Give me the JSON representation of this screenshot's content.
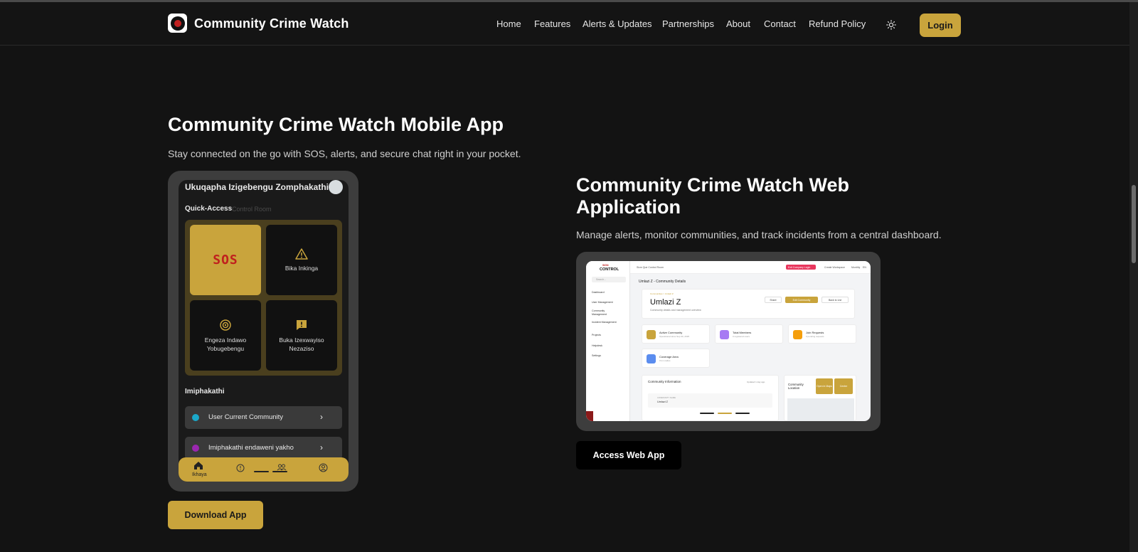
{
  "header": {
    "brand": "Community Crime Watch",
    "nav": [
      "Home",
      "Features",
      "Alerts & Updates",
      "Partnerships",
      "About",
      "Contact",
      "Refund Policy"
    ],
    "login_label": "Login",
    "theme_icon": "sun-icon"
  },
  "mobile": {
    "title": "Community Crime Watch Mobile App",
    "description": "Stay connected on the go with SOS, alerts, and secure chat right in your pocket.",
    "download_label": "Download App",
    "phone": {
      "title": "Ukuqapha Izigebengu Zomphakathi",
      "quick_access": "Quick-Access",
      "ghost_text": "Control Room",
      "tiles": [
        {
          "label": "SOS",
          "icon": "sos-text"
        },
        {
          "label": "Bika Inkinga",
          "icon": "warning-icon"
        },
        {
          "label": "Engeza Indawo Yobugebengu",
          "icon": "target-icon"
        },
        {
          "label": "Buka Izexwayiso Nezaziso",
          "icon": "alert-message-icon"
        }
      ],
      "section_title": "Imiphakathi",
      "rows": [
        {
          "label": "User Current Community",
          "dot_color": "#1ba8c9"
        },
        {
          "label": "Imiphakathi endaweni yakho",
          "dot_color": "#9b27b0"
        }
      ],
      "tab_home_label": "Ikhaya"
    }
  },
  "web": {
    "title": "Community Crime Watch Web Application",
    "description": "Manage alerts, monitor communities, and track incidents from a central dashboard.",
    "access_label": "Access Web App",
    "dashboard": {
      "logo_top": "SIGN",
      "logo": "CONTROL",
      "search": "Search...",
      "sidebar": [
        "Dashboard",
        "User Management",
        "Community Management",
        "Incident Management",
        "Projects",
        "Helpdesk",
        "Settings"
      ],
      "workspace": "Sicm Que Control Room",
      "exit_label": "Exit Company Login",
      "create_workspace": "Create Workspace",
      "month": "Monthly",
      "lang": "EN",
      "page_title": "Umlazi Z - Community Details",
      "breadcrumb": "Communities  >  Umlazi Z",
      "community_name": "Umlazi Z",
      "community_sub": "Community details and management overview",
      "share": "Share",
      "edit": "Edit Community",
      "back": "Back to List",
      "stats": [
        {
          "title": "Active Community",
          "sub": "Operational since Sep 30, 2025",
          "color": "#c9a43c"
        },
        {
          "title": "Total Members",
          "sub": "0 registered users",
          "color": "#a77bf3"
        },
        {
          "title": "Join Requests",
          "sub": "0 pending requests",
          "color": "#f59e0b"
        },
        {
          "title": "Coverage Area",
          "sub": "0 km radius",
          "color": "#5b8def"
        }
      ],
      "info_title": "Community Information",
      "updated": "Updated 1 day ago",
      "location_title": "Community Location",
      "open_maps": "Open in Maps",
      "center": "Center",
      "field_label": "COMMUNITY NAME",
      "field_value": "Umlazi Z"
    }
  },
  "colors": {
    "accent": "#c9a43c",
    "background": "#131313",
    "sos_red": "#c0201e"
  }
}
